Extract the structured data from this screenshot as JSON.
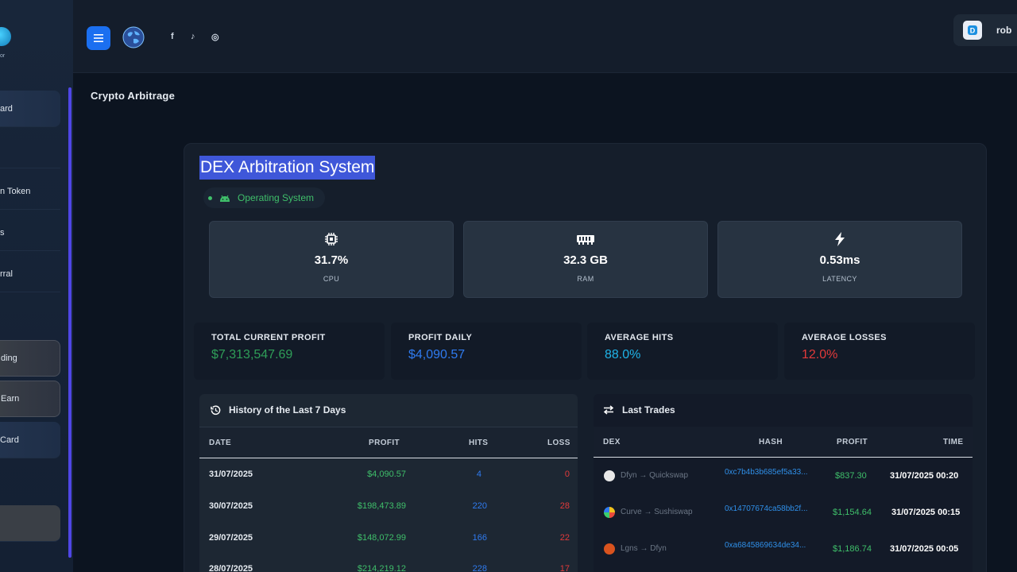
{
  "sidebar": {
    "logo_text": "or",
    "items": [
      {
        "label": "ard"
      },
      {
        "label": ""
      },
      {
        "label": "n Token"
      },
      {
        "label": "s"
      },
      {
        "label": "rral"
      },
      {
        "label": "ding"
      },
      {
        "label": "Earn"
      },
      {
        "label": "Card"
      },
      {
        "label": ""
      }
    ]
  },
  "topbar": {
    "social": [
      "f",
      "♪",
      "◎"
    ],
    "user_name": "rob"
  },
  "page": {
    "title": "Crypto Arbitrage"
  },
  "system": {
    "title": "DEX Arbitration System",
    "status": "Operating System",
    "stats": [
      {
        "icon": "cpu-icon",
        "value": "31.7%",
        "label": "CPU"
      },
      {
        "icon": "ram-icon",
        "value": "32.3 GB",
        "label": "RAM"
      },
      {
        "icon": "lightning-icon",
        "value": "0.53ms",
        "label": "LATENCY"
      }
    ],
    "metrics": [
      {
        "label": "TOTAL CURRENT PROFIT",
        "value": "$7,313,547.69",
        "color": "#2f9e58"
      },
      {
        "label": "PROFIT DAILY",
        "value": "$4,090.57",
        "color": "#2f7bf0"
      },
      {
        "label": "AVERAGE HITS",
        "value": "88.0%",
        "color": "#1fb4e8"
      },
      {
        "label": "AVERAGE LOSSES",
        "value": "12.0%",
        "color": "#e23a3a"
      }
    ]
  },
  "history": {
    "title": "History of the Last 7 Days",
    "columns": [
      "DATE",
      "PROFIT",
      "HITS",
      "LOSS"
    ],
    "rows": [
      {
        "date": "31/07/2025",
        "profit": "$4,090.57",
        "hits": "4",
        "loss": "0"
      },
      {
        "date": "30/07/2025",
        "profit": "$198,473.89",
        "hits": "220",
        "loss": "28"
      },
      {
        "date": "29/07/2025",
        "profit": "$148,072.99",
        "hits": "166",
        "loss": "22"
      },
      {
        "date": "28/07/2025",
        "profit": "$214,219.12",
        "hits": "228",
        "loss": "17"
      }
    ]
  },
  "trades": {
    "title": "Last Trades",
    "columns": [
      "DEX",
      "HASH",
      "PROFIT",
      "TIME"
    ],
    "rows": [
      {
        "dex": "Dfyn → Quickswap",
        "hash": "0xc7b4b3b685ef5a33...",
        "profit": "$837.30",
        "time": "31/07/2025 00:20",
        "coin_color": "#e8e8e8"
      },
      {
        "dex": "Curve → Sushiswap",
        "hash": "0x14707674ca58bb2f...",
        "profit": "$1,154.64",
        "time": "31/07/2025 00:15",
        "coin_color": "#f0c21e"
      },
      {
        "dex": "Lgns → Dfyn",
        "hash": "0xa6845869634de34...",
        "profit": "$1,186.74",
        "time": "31/07/2025 00:05",
        "coin_color": "#d9531e"
      }
    ]
  }
}
